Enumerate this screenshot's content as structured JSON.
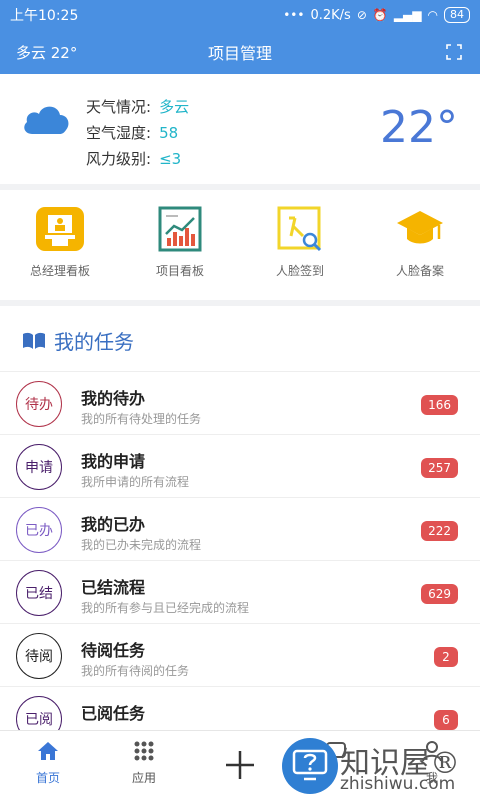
{
  "status_bar": {
    "time": "上午10:25",
    "network_speed": "0.2K/s",
    "battery": "84"
  },
  "header": {
    "weather_short": "多云 22°",
    "title": "项目管理",
    "fullscreen_icon": "fullscreen-icon"
  },
  "weather": {
    "rows": [
      {
        "key": "天气情况:",
        "value": "多云"
      },
      {
        "key": "空气湿度:",
        "value": "58"
      },
      {
        "key": "风力级别:",
        "value": "≤3"
      }
    ],
    "temperature": "22°",
    "icon": "cloud-icon"
  },
  "quick_actions": [
    {
      "label": "总经理看板",
      "icon": "manager-board-icon"
    },
    {
      "label": "项目看板",
      "icon": "project-board-icon"
    },
    {
      "label": "人脸签到",
      "icon": "face-checkin-icon"
    },
    {
      "label": "人脸备案",
      "icon": "face-record-icon"
    }
  ],
  "tasks_section": {
    "title": "我的任务",
    "icon": "book-icon"
  },
  "tasks": [
    {
      "tag": "待办",
      "title": "我的待办",
      "desc": "我的所有待处理的任务",
      "count": "166",
      "color": "#b0334a"
    },
    {
      "tag": "申请",
      "title": "我的申请",
      "desc": "我所申请的所有流程",
      "count": "257",
      "color": "#4a1f6b"
    },
    {
      "tag": "已办",
      "title": "我的已办",
      "desc": "我的已办未完成的流程",
      "count": "222",
      "color": "#7c5cc4"
    },
    {
      "tag": "已结",
      "title": "已结流程",
      "desc": "我的所有参与且已经完成的流程",
      "count": "629",
      "color": "#4a1f6b"
    },
    {
      "tag": "待阅",
      "title": "待阅任务",
      "desc": "我的所有待阅的任务",
      "count": "2",
      "color": "#222222"
    },
    {
      "tag": "已阅",
      "title": "已阅任务",
      "desc": "",
      "count": "6",
      "color": "#4a1f6b"
    }
  ],
  "tab_bar": [
    {
      "label": "首页",
      "icon": "home-icon",
      "active": true
    },
    {
      "label": "应用",
      "icon": "grid-icon",
      "active": false
    },
    {
      "label": "",
      "icon": "plus-icon",
      "active": false
    },
    {
      "label": "",
      "icon": "message-icon",
      "active": false
    },
    {
      "label": "我",
      "icon": "user-icon",
      "active": false
    }
  ],
  "watermark": {
    "brand": "知识屋®",
    "domain": "zhishiwu.com"
  },
  "colors": {
    "primary": "#4a90e2",
    "badge": "#e05252",
    "accent_text": "#22b5c9",
    "temp": "#4a78d6"
  }
}
